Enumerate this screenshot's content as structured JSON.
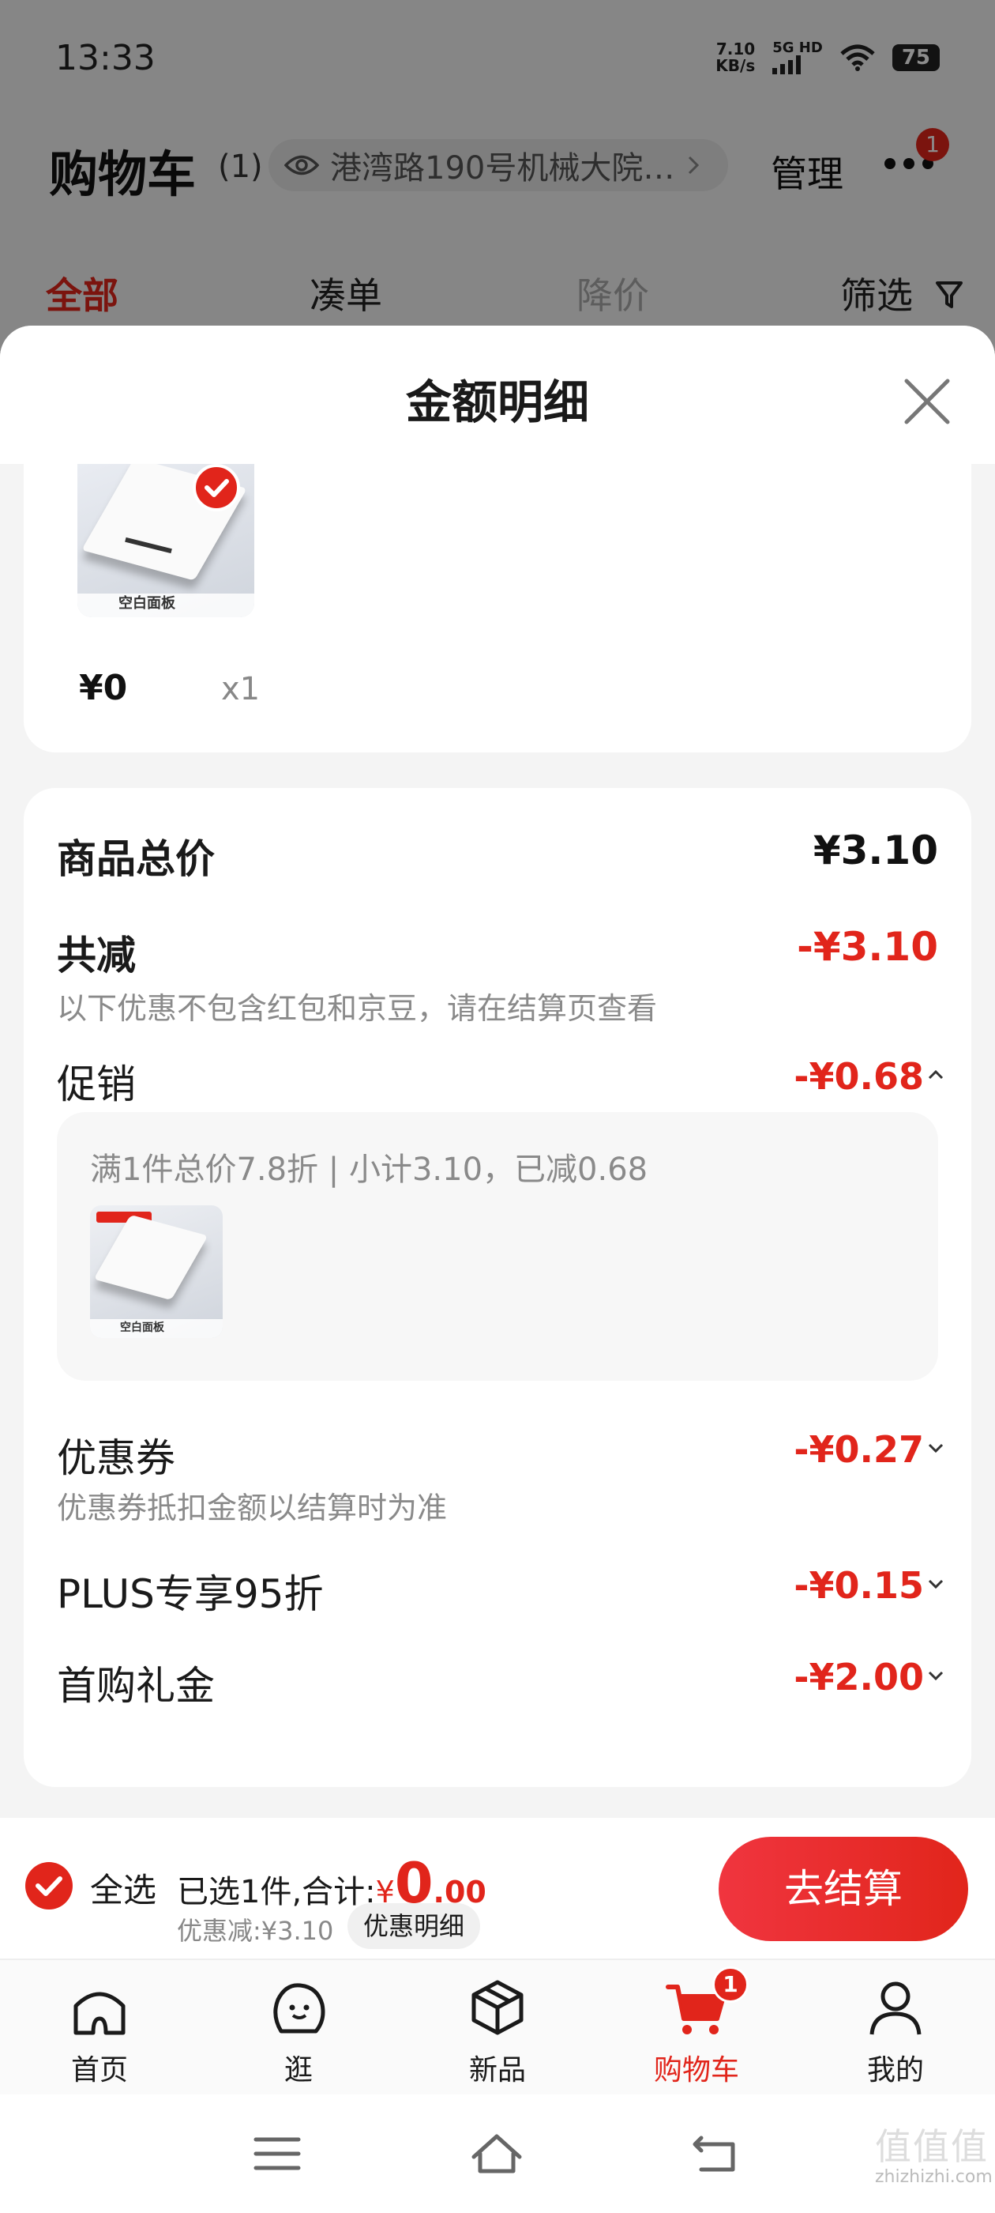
{
  "status_bar": {
    "time": "13:33",
    "net_speed_value": "7.10",
    "net_speed_unit": "KB/s",
    "signal_label": "5G HD",
    "battery": "75"
  },
  "header": {
    "title": "购物车",
    "count": "(1)",
    "address": "港湾路190号机械大院…",
    "manage": "管理",
    "more_badge": "1"
  },
  "filter_tabs": {
    "all": "全部",
    "bundle": "凑单",
    "price_drop": "降价",
    "filter": "筛选"
  },
  "sheet": {
    "title": "金额明细",
    "product": {
      "thumb_label": "空白面板",
      "price": "¥0",
      "qty": "x1"
    },
    "total_label": "商品总价",
    "total_value": "¥3.10",
    "reduce_label": "共减",
    "reduce_value": "-¥3.10",
    "reduce_note": "以下优惠不包含红包和京豆，请在结算页查看",
    "promo_label": "促销",
    "promo_value": "-¥0.68",
    "promo_detail": "满1件总价7.8折 | 小计3.10，已减0.68",
    "promo_thumb_label": "空白面板",
    "coupon_label": "优惠券",
    "coupon_value": "-¥0.27",
    "coupon_note": "优惠券抵扣金额以结算时为准",
    "plus_label": "PLUS专享95折",
    "plus_value": "-¥0.15",
    "gift_label": "首购礼金",
    "gift_value": "-¥2.00"
  },
  "checkout": {
    "select_all": "全选",
    "selected_prefix": "已选1件,合计:",
    "yen": "¥",
    "total_int": "0",
    "total_dec": ".00",
    "discount": "优惠减:¥3.10",
    "detail_button": "优惠明细",
    "checkout_button": "去结算"
  },
  "tab_bar": {
    "tabs": [
      {
        "label": "首页",
        "icon": "home-icon"
      },
      {
        "label": "逛",
        "icon": "browse-icon"
      },
      {
        "label": "新品",
        "icon": "new-product-icon"
      },
      {
        "label": "购物车",
        "icon": "cart-icon",
        "badge": "1"
      },
      {
        "label": "我的",
        "icon": "profile-icon"
      }
    ]
  },
  "watermark": {
    "text": "zhizhizhi.com",
    "logo": "值值值"
  },
  "colors": {
    "accent": "#e1251b",
    "muted_text": "#8a8a8a"
  }
}
